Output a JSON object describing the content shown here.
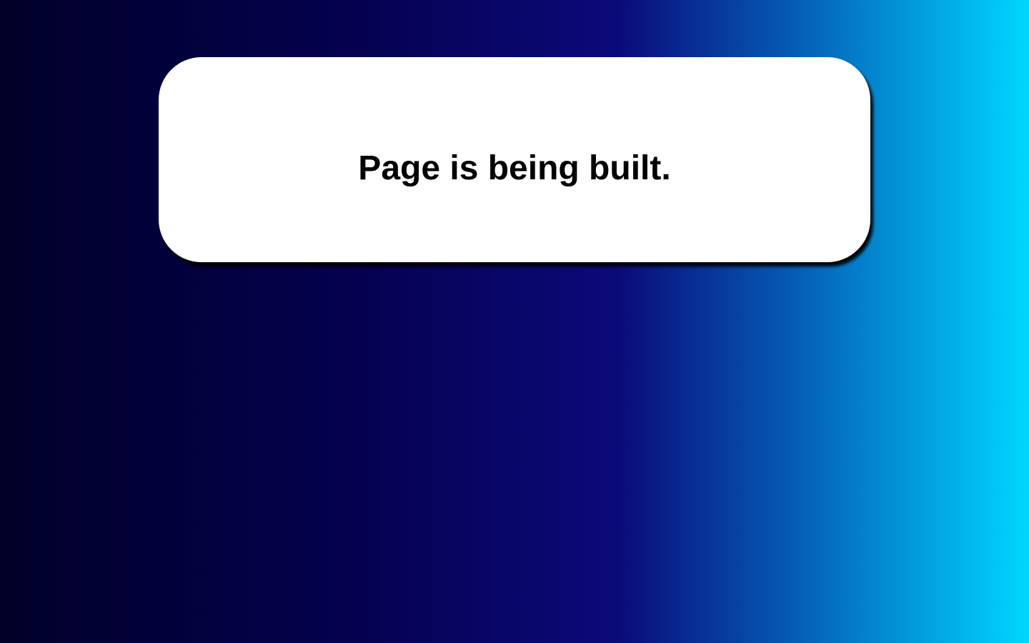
{
  "message": {
    "text": "Page is being built."
  },
  "colors": {
    "card_background": "#ffffff",
    "text": "#000000",
    "gradient_start": "#000028",
    "gradient_mid": "#0b0a7a",
    "gradient_end": "#00d7ff"
  }
}
